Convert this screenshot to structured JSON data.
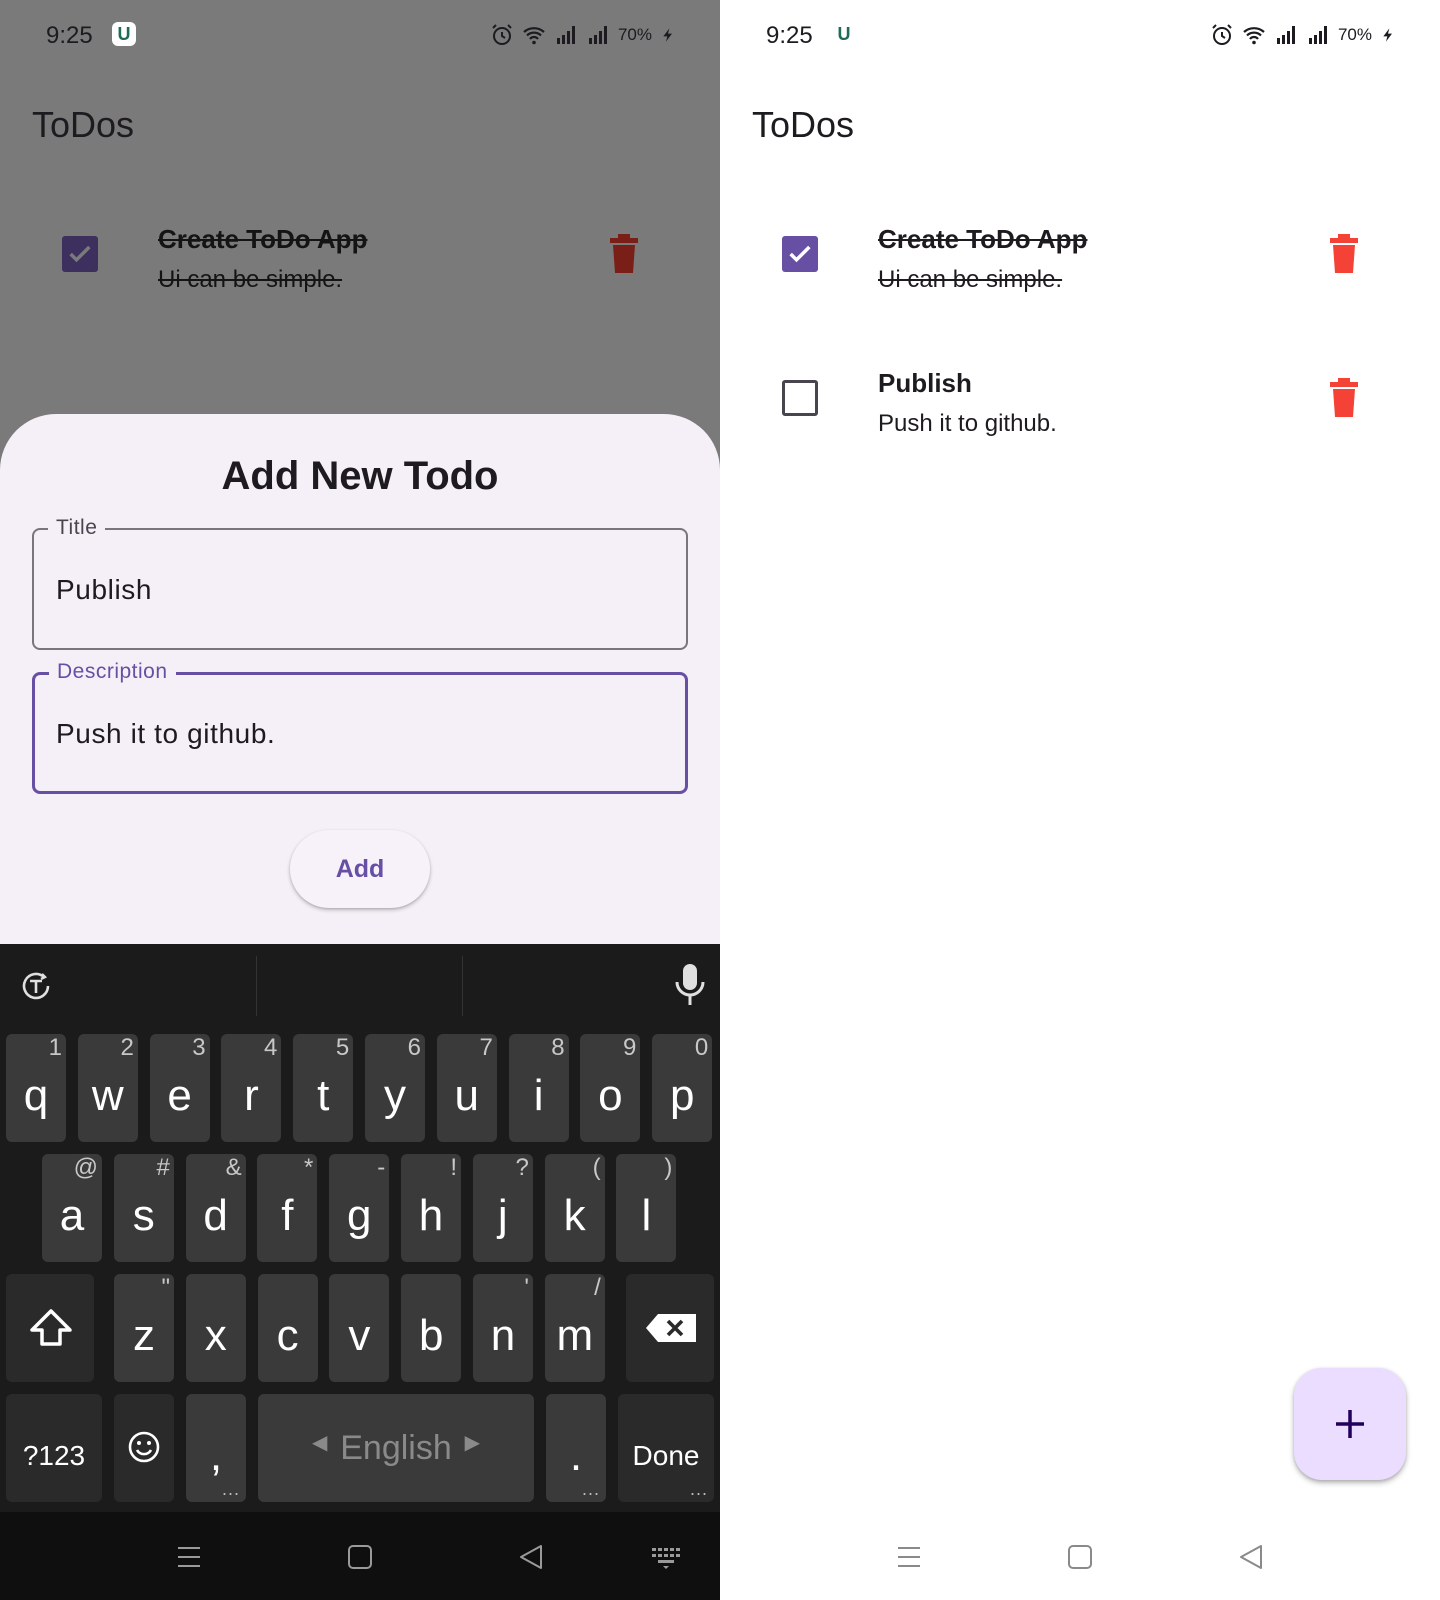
{
  "left_screen": {
    "status_bar": {
      "time": "9:25",
      "app_icon": "U",
      "battery": "70%"
    },
    "app_bar": {
      "title": "ToDos"
    },
    "todos": [
      {
        "title": "Create ToDo App",
        "description": "Ui can be simple.",
        "done": true
      }
    ],
    "sheet": {
      "title": "Add New Todo",
      "title_field": {
        "label": "Title",
        "value": "Publish"
      },
      "description_field": {
        "label": "Description",
        "value": "Push it to github."
      },
      "add_button": "Add"
    },
    "keyboard": {
      "row1": [
        {
          "key": "q",
          "hint": "1"
        },
        {
          "key": "w",
          "hint": "2"
        },
        {
          "key": "e",
          "hint": "3"
        },
        {
          "key": "r",
          "hint": "4"
        },
        {
          "key": "t",
          "hint": "5"
        },
        {
          "key": "y",
          "hint": "6"
        },
        {
          "key": "u",
          "hint": "7"
        },
        {
          "key": "i",
          "hint": "8"
        },
        {
          "key": "o",
          "hint": "9"
        },
        {
          "key": "p",
          "hint": "0"
        }
      ],
      "row2": [
        {
          "key": "a",
          "hint": "@"
        },
        {
          "key": "s",
          "hint": "#"
        },
        {
          "key": "d",
          "hint": "&"
        },
        {
          "key": "f",
          "hint": "*"
        },
        {
          "key": "g",
          "hint": "-"
        },
        {
          "key": "h",
          "hint": "!"
        },
        {
          "key": "j",
          "hint": "?"
        },
        {
          "key": "k",
          "hint": "("
        },
        {
          "key": "l",
          "hint": ")"
        }
      ],
      "row3": [
        {
          "key": "z",
          "hint": "\""
        },
        {
          "key": "x",
          "hint": ""
        },
        {
          "key": "c",
          "hint": ""
        },
        {
          "key": "v",
          "hint": ""
        },
        {
          "key": "b",
          "hint": ""
        },
        {
          "key": "n",
          "hint": "'"
        },
        {
          "key": "m",
          "hint": "/"
        }
      ],
      "symbols_key": "?123",
      "comma_key": ",",
      "space_label": "English",
      "period_key": ".",
      "done_key": "Done",
      "more_dots": "..."
    }
  },
  "right_screen": {
    "status_bar": {
      "time": "9:25",
      "app_icon": "U",
      "battery": "70%"
    },
    "app_bar": {
      "title": "ToDos"
    },
    "todos": [
      {
        "title": "Create ToDo App",
        "description": "Ui can be simple.",
        "done": true
      },
      {
        "title": "Publish",
        "description": "Push it to github.",
        "done": false
      }
    ]
  },
  "colors": {
    "primary": "#6750a4",
    "delete_red": "#f44336",
    "fab_background": "#eaddff",
    "scrim": "#7a7a7a"
  },
  "icons": [
    "alarm-icon",
    "wifi-icon",
    "signal-icon",
    "charging-icon",
    "check-icon",
    "trash-icon",
    "plus-icon",
    "translate-icon",
    "microphone-icon",
    "shift-icon",
    "backspace-icon",
    "emoji-icon",
    "menu-nav-icon",
    "home-nav-icon",
    "back-nav-icon",
    "keyboard-nav-icon"
  ]
}
